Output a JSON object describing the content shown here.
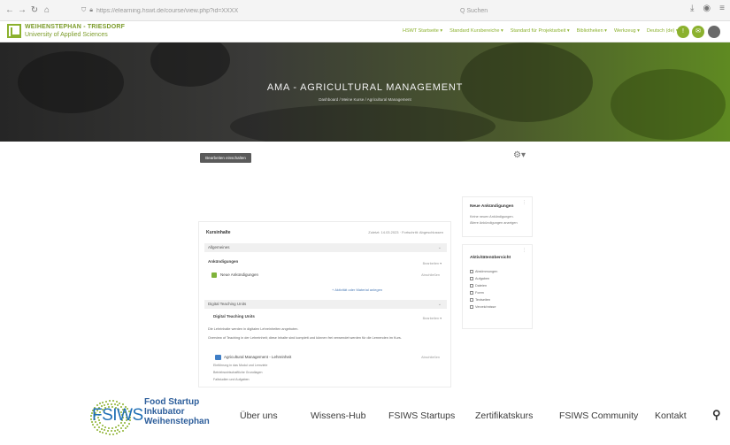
{
  "browser": {
    "url": "https://elearning.hswt.de/course/view.php?id=XXXX",
    "search_placeholder": "Q Suchen"
  },
  "site": {
    "logo_title": "WEIHENSTEPHAN - TRIESDORF",
    "logo_subtitle": "University of Applied Sciences",
    "nav": [
      "HSWT Startseite ▾",
      "Standard Kursbereiche ▾",
      "Standard für Projektarbeit ▾",
      "Bibliotheken ▾",
      "Werkzeug ▾",
      "Deutsch (de) ▾"
    ],
    "notif_icon": "bell-icon",
    "chat_icon": "chat-icon"
  },
  "hero": {
    "title": "AMA - AGRICULTURAL MANAGEMENT",
    "breadcrumb": "Dashboard / Meine Kurse / Agricultural Management"
  },
  "toolbar": {
    "edit_toggle": "Bearbeiten einschalten",
    "settings_icon": "gear-icon"
  },
  "course": {
    "header": "Kursinhalte",
    "meta": "Zuletzt: 14.03.2023 · Fortschritt: Abgeschlossen",
    "sections": [
      {
        "title": "Allgemeines",
        "expanded": true
      },
      {
        "title": "Digital Teaching Units",
        "expanded": true
      }
    ],
    "announcements": "Ankündigungen",
    "announcement_item": "Neue Ankündigungen",
    "activity_label": "Abschließen",
    "add_activity": "+ Aktivität oder Material anlegen",
    "dtu_title": "Digital Teaching Units",
    "dtu_para1": "Die Lehrinhalte werden in digitalen Lehreinheiten angeboten.",
    "dtu_para2": "Overview of Teaching in der Lehreinheit; diese Inhalte sind komplett und können frei verwendet werden für die Lernenden im Kurs.",
    "dtu_item": "Agricultural Management - Lehreinheit",
    "dtu_bullets": [
      "Einführung in das Modul und Lernziele",
      "Betriebswirtschaftliche Grundlagen",
      "Fallstudien und Aufgaben"
    ]
  },
  "sidebar": {
    "news_title": "Neue Ankündigungen",
    "news_text1": "Keine neuen Ankündigungen.",
    "news_text2": "Ältere Ankündigungen anzeigen",
    "activity_title": "Aktivitätenübersicht",
    "activity_items": [
      "Abstimmungen",
      "Aufgaben",
      "Dateien",
      "Foren",
      "Textseiten",
      "Verzeichnisse"
    ]
  },
  "fsiws": {
    "logo": "FSIWS",
    "tagline": [
      "Food Startup",
      "Inkubator",
      "Weihenstephan"
    ],
    "nav": [
      "Über uns",
      "Wissens-Hub",
      "FSIWS Startups",
      "Zertifikatskurs",
      "FSIWS Community",
      "Kontakt"
    ],
    "search_icon": "search-icon"
  }
}
